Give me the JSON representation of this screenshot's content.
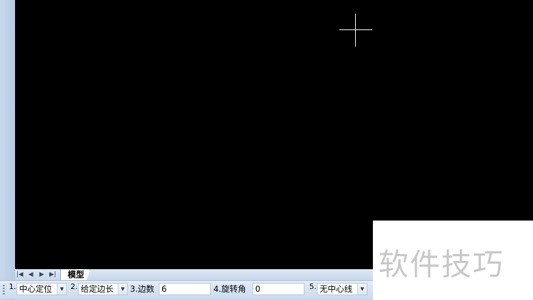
{
  "tabs": {
    "nav": [
      "|◀",
      "◀",
      "▶",
      "▶|"
    ],
    "model_tab": "模型"
  },
  "command_bar": {
    "center_pos": {
      "number": "1.",
      "value": "中心定位"
    },
    "side_len": {
      "number": "2.",
      "value": "给定边长"
    },
    "sides": {
      "label": "3.边数",
      "value": "6"
    },
    "rotation": {
      "label": "4.旋转角",
      "value": "0"
    },
    "center_line": {
      "number": "5.",
      "value": "无中心线"
    }
  },
  "watermark": "软件技巧",
  "colors": {
    "canvas": "#000000",
    "crosshair": "#ffffff"
  }
}
